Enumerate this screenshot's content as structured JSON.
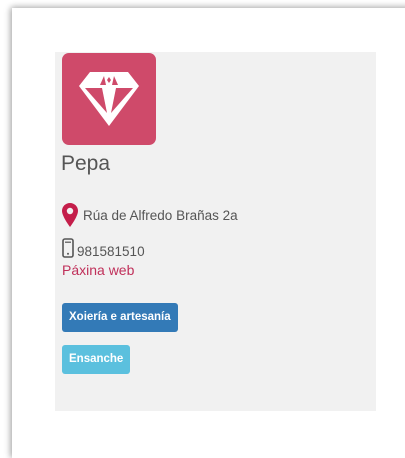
{
  "business": {
    "name": "Pepa",
    "address": "Rúa de Alfredo Brañas 2a",
    "phone": "981581510",
    "website_label": "Páxina web"
  },
  "tags": {
    "category": "Xoiería e artesanía",
    "zone": "Ensanche"
  },
  "icons": {
    "logo": "diamond-icon",
    "address": "map-marker-icon",
    "phone": "mobile-phone-icon"
  },
  "colors": {
    "logo_background": "#cf4a6a",
    "link": "#c0305a",
    "marker": "#c41e4a",
    "tag_primary": "#337ab7",
    "tag_secondary": "#5bc0de"
  }
}
